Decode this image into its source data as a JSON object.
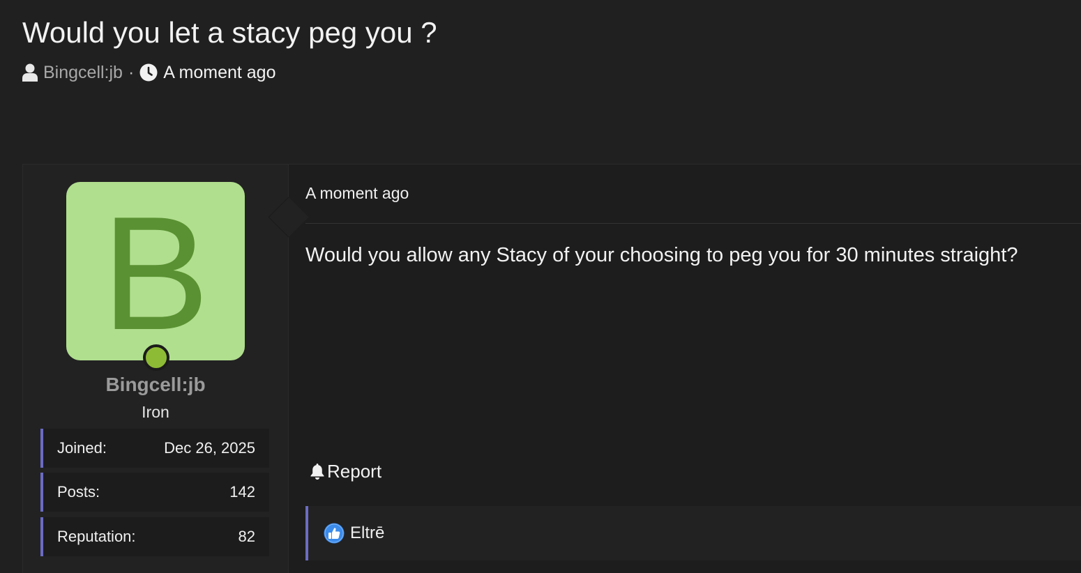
{
  "thread": {
    "title": "Would you let a stacy peg you ?",
    "author": "Bingcell:jb",
    "separator": "·",
    "time": "A moment ago"
  },
  "user": {
    "avatar_letter": "B",
    "avatar_bg": "#b0df8e",
    "avatar_fg": "#5a9132",
    "status_color": "#8ebb35",
    "name": "Bingcell:jb",
    "rank": "Iron",
    "stats": [
      {
        "label": "Joined:",
        "value": "Dec 26, 2025"
      },
      {
        "label": "Posts:",
        "value": "142"
      },
      {
        "label": "Reputation:",
        "value": "82"
      }
    ]
  },
  "post": {
    "time": "A moment ago",
    "text": "Would you allow any Stacy of your choosing to peg you for 30 minutes straight?",
    "report_label": "Report",
    "likes": {
      "icon": "thumbs-up-icon",
      "user": "Eltrē"
    }
  },
  "colors": {
    "background": "#202020",
    "accent": "#6b6bc4",
    "like_blue": "#3b8beb"
  }
}
